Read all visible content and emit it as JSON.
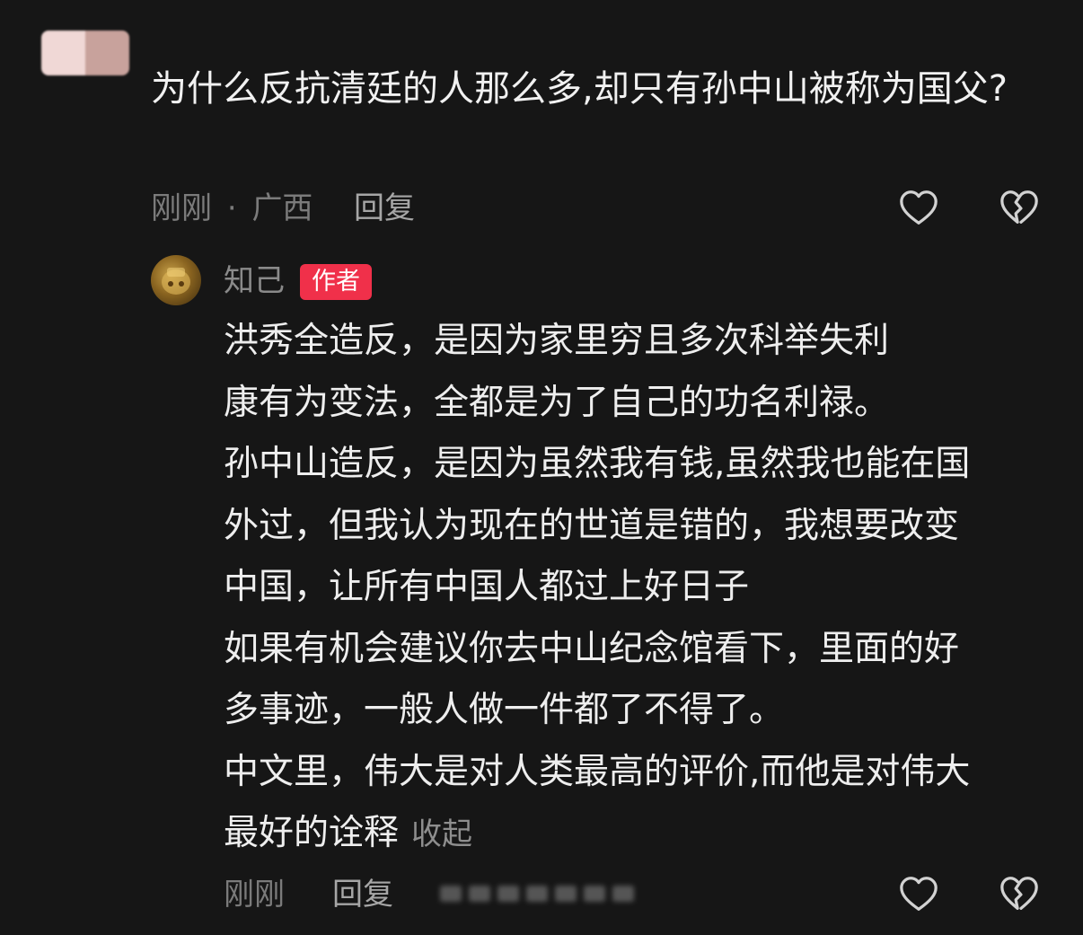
{
  "question_comment": {
    "text": "为什么反抗清廷的人那么多,却只有孙中山被称为国父?",
    "time": "刚刚",
    "separator": "·",
    "location": "广西",
    "reply_label": "回复"
  },
  "author_reply": {
    "name": "知己",
    "badge": "作者",
    "lines": [
      "洪秀全造反，是因为家里穷且多次科举失利",
      "康有为变法，全都是为了自己的功名利禄。",
      "孙中山造反，是因为虽然我有钱,虽然我也能在国",
      "外过，但我认为现在的世道是错的，我想要改变",
      "中国，让所有中国人都过上好日子",
      "如果有机会建议你去中山纪念馆看下，里面的好",
      "多事迹，一般人做一件都了不得了。",
      "中文里，伟大是对人类最高的评价,而他是对伟大",
      "最好的诠释"
    ],
    "collapse_label": "收起",
    "time": "刚刚",
    "reply_label": "回复"
  },
  "icons": {
    "like": "heart-outline-icon",
    "dislike": "broken-heart-icon"
  },
  "colors": {
    "background": "#161616",
    "badge": "#f0304a"
  }
}
